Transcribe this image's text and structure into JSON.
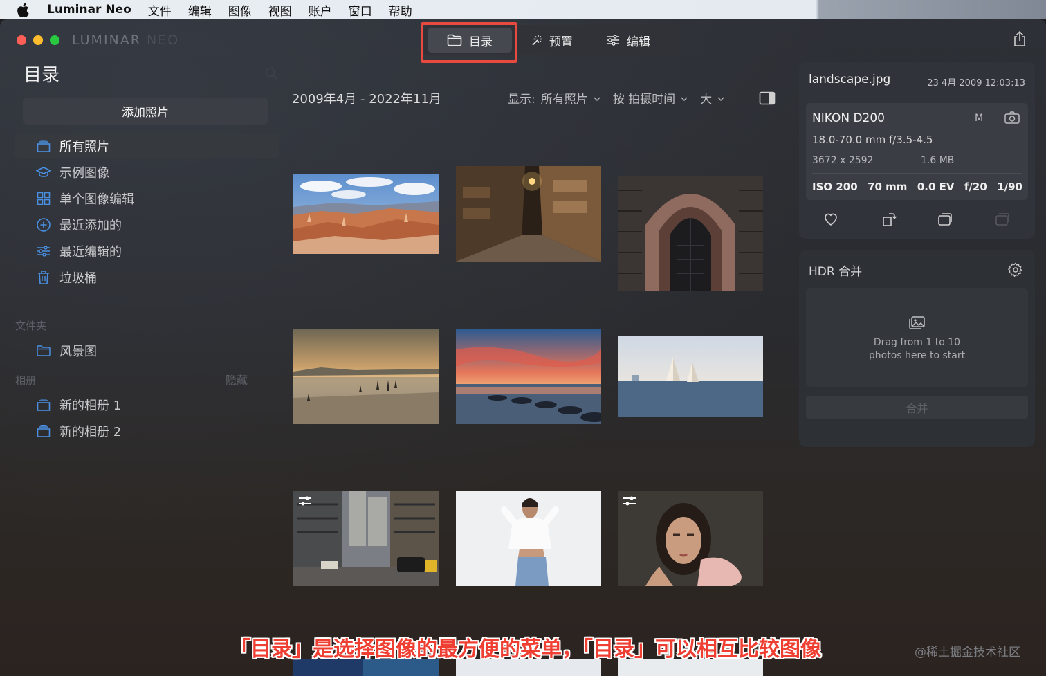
{
  "menubar": {
    "app_name": "Luminar Neo",
    "items": [
      "文件",
      "编辑",
      "图像",
      "视图",
      "账户",
      "窗口",
      "帮助"
    ]
  },
  "window": {
    "brand": "LUMINAR",
    "brand_suffix": "NEO"
  },
  "modes": {
    "catalog": "目录",
    "presets": "预置",
    "edit": "编辑"
  },
  "sidebar": {
    "title": "目录",
    "add_photos": "添加照片",
    "items": [
      {
        "label": "所有照片",
        "icon": "stack-icon"
      },
      {
        "label": "示例图像",
        "icon": "graduation-cap-icon"
      },
      {
        "label": "单个图像编辑",
        "icon": "grid-icon"
      },
      {
        "label": "最近添加的",
        "icon": "plus-circle-icon"
      },
      {
        "label": "最近编辑的",
        "icon": "sliders-icon"
      },
      {
        "label": "垃圾桶",
        "icon": "trash-icon"
      }
    ],
    "folders_label": "文件夹",
    "folders": [
      "风景图"
    ],
    "albums_label": "相册",
    "albums_hide": "隐藏",
    "albums": [
      "新的相册 1",
      "新的相册 2"
    ]
  },
  "grid": {
    "date_range": "2009年4月 - 2022年11月",
    "show_label": "显示:",
    "show_value": "所有照片",
    "sort_value": "按 拍摄时间",
    "size_value": "大"
  },
  "info": {
    "filename": "landscape.jpg",
    "datetime": "23 4月 2009 12:03:13",
    "camera": "NIKON D200",
    "mode": "M",
    "lens": "18.0-70.0 mm f/3.5-4.5",
    "resolution": "3672 x 2592",
    "filesize": "1.6 MB",
    "iso": "ISO 200",
    "focal": "70 mm",
    "ev": "0.0 EV",
    "aperture": "f/20",
    "shutter": "1/90"
  },
  "hdr": {
    "title": "HDR 合并",
    "drop_line1": "Drag from 1 to 10",
    "drop_line2": "photos here to start",
    "merge": "合并"
  },
  "overlay": {
    "caption": "「目录」是选择图像的最方便的菜单，「目录」可以相互比较图像",
    "watermark": "@稀土掘金技术社区"
  },
  "colors": {
    "accent_blue": "#4a90e2",
    "highlight_red": "#e84a3f"
  }
}
